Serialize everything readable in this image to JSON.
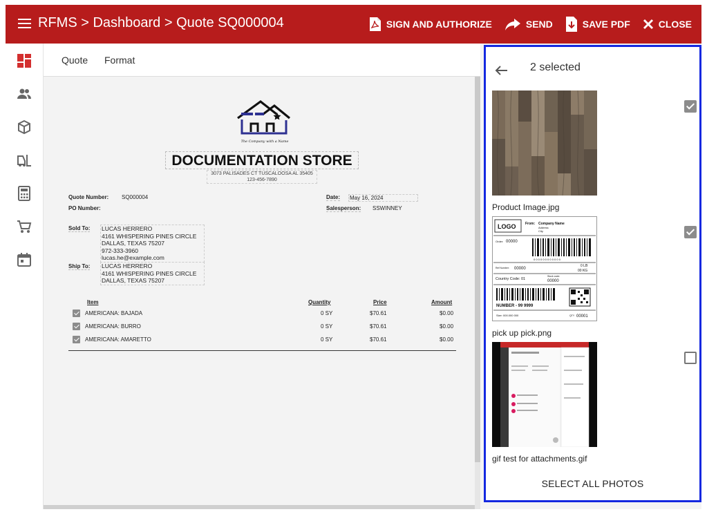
{
  "appbar": {
    "title": "RFMS > Dashboard > Quote SQ000004",
    "actions": [
      {
        "label": "SIGN AND AUTHORIZE",
        "icon": "pdf-icon"
      },
      {
        "label": "SEND",
        "icon": "send-arrow-icon"
      },
      {
        "label": "SAVE PDF",
        "icon": "save-pdf-icon"
      },
      {
        "label": "CLOSE",
        "icon": "close-icon"
      }
    ]
  },
  "sidebar": {
    "items": [
      {
        "icon": "dashboard-icon",
        "active": true
      },
      {
        "icon": "people-icon"
      },
      {
        "icon": "box-icon"
      },
      {
        "icon": "forklift-icon"
      },
      {
        "icon": "calculator-icon"
      },
      {
        "icon": "cart-icon"
      },
      {
        "icon": "calendar-icon"
      }
    ]
  },
  "tabs": [
    "Quote",
    "Format"
  ],
  "document": {
    "logo_tagline": "The Company with a Name",
    "store_name": "DOCUMENTATION STORE",
    "address": "3073 PALISADES CT TUSCALOOSA AL 35405",
    "phone": "123-456-7890",
    "quote_number_label": "Quote Number:",
    "quote_number": "SQ000004",
    "po_number_label": "PO Number:",
    "date_label": "Date:",
    "date": "May 16, 2024",
    "salesperson_label": "Salesperson:",
    "salesperson": "SSWINNEY",
    "sold_to_label": "Sold To:",
    "sold_to": [
      "LUCAS HERRERO",
      "4161 WHISPERING PINES CIRCLE",
      "DALLAS, TEXAS 75207",
      "972-333-3960",
      "lucas.he@example.com"
    ],
    "ship_to_label": "Ship To:",
    "ship_to": [
      "LUCAS HERRERO",
      "4161 WHISPERING PINES CIRCLE",
      "DALLAS, TEXAS 75207"
    ],
    "columns": {
      "item": "Item",
      "quantity": "Quantity",
      "price": "Price",
      "amount": "Amount"
    },
    "lines": [
      {
        "item": "AMERICANA: BAJADA",
        "quantity": "0 SY",
        "price": "$70.61",
        "amount": "$0.00",
        "checked": true
      },
      {
        "item": "AMERICANA: BURRO",
        "quantity": "0 SY",
        "price": "$70.61",
        "amount": "$0.00",
        "checked": true
      },
      {
        "item": "AMERICANA: AMARETTO",
        "quantity": "0 SY",
        "price": "$70.61",
        "amount": "$0.00",
        "checked": true
      }
    ]
  },
  "photo_panel": {
    "selected_text": "2 selected",
    "photos": [
      {
        "caption": "Product Image.jpg",
        "checked": true
      },
      {
        "caption": "pick up pick.png",
        "checked": true
      },
      {
        "caption": "gif test for attachments.gif",
        "checked": false
      }
    ],
    "select_all_label": "SELECT ALL PHOTOS"
  },
  "label_image": {
    "logo": "LOGO",
    "from": "From:",
    "company": "Company Name",
    "address": "Address",
    "city": "City",
    "order_label": "Order:",
    "order_value": "00000",
    "barcode_digits": "0 0 0 0 0 0 0 0 0 0 0 0",
    "ref_label": "Ref Number:",
    "ref_value": "00000",
    "weight_lb": "0 LB",
    "weight_kg": "00 KG",
    "country_code": "Country Code: 01",
    "stock_label": "Stock code:",
    "stock_value": "00000",
    "number": "NUMBER - 99 9999",
    "size": "Size: 000.000 000",
    "qty_label": "QTY",
    "qty_value": "00001"
  },
  "colors": {
    "appbar": "#b71c1c",
    "panel_border": "#1428e0",
    "checkbox": "#8c8c8c",
    "accent_icon": "#d32f2f"
  }
}
